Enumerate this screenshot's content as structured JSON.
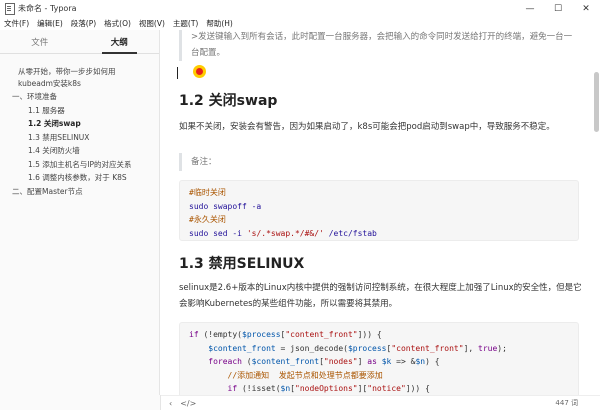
{
  "window": {
    "title": "未命名 - Typora",
    "controls": {
      "minimize": "—",
      "maximize": "☐",
      "close": "✕"
    }
  },
  "menu": [
    "文件(F)",
    "编辑(E)",
    "段落(P)",
    "格式(O)",
    "视图(V)",
    "主题(T)",
    "帮助(H)"
  ],
  "sidebar": {
    "tabs": {
      "files": "文件",
      "outline": "大纲"
    },
    "outline": [
      "从零开始，带你一步步如何用",
      "kubeadm安装k8s",
      "一、环境准备",
      "1.1 服务器",
      "1.2 关闭swap",
      "1.3 禁用SELINUX",
      "1.4 关闭防火墙",
      "1.5 添加主机名与IP的对应关系",
      "1.6 调整内核参数，对于 K8S",
      "二、配置Master节点"
    ]
  },
  "editor": {
    "quote_continuation": ">发送键输入到所有会话，此时配置一台服务器，会把输入的命令同时发送给打开的终端，避免一台一台配置。",
    "heading_swap": "1.2 关闭swap",
    "para_swap": "如果不关闭，安装会有警告，因为如果启动了，k8s可能会把pod启动到swap中，导致服务不稳定。",
    "note": "备注：",
    "code_swap": {
      "line1": "#临时关闭",
      "line2": "sudo swapoff -a",
      "line3": "#永久关闭",
      "line4_cmd": "sudo sed -i",
      "line4_str": "'s/.*swap.*/#&/'",
      "line4_rest": " /etc/fstab"
    },
    "heading_selinux": "1.3 禁用SELINUX",
    "para_selinux": "selinux是2.6+版本的Linux内核中提供的强制访问控制系统，在很大程度上加强了Linux的安全性，但是它会影响Kubernetes的某些组件功能，所以需要将其禁用。",
    "code_php": {
      "l1_kw": "if",
      "l1_a": " (!empty(",
      "l1_var": "$process",
      "l1_b": "[",
      "l1_str": "\"content_front\"",
      "l1_c": "])) {",
      "l2_var": "$content_front",
      "l2_a": " = json_decode(",
      "l2_var2": "$process",
      "l2_b": "[",
      "l2_str": "\"content_front\"",
      "l2_c": "], ",
      "l2_kw": "true",
      "l2_d": ");",
      "l3_kw": "foreach",
      "l3_a": " (",
      "l3_var": "$content_front",
      "l3_b": "[",
      "l3_str": "\"nodes\"",
      "l3_c": "] ",
      "l3_kw2": "as",
      "l3_d": " ",
      "l3_var2": "$k",
      "l3_e": " => &",
      "l3_var3": "$n",
      "l3_f": ") {",
      "l4_cmt": "//添加通知  发起节点和处理节点都要添加",
      "l5_kw": "if",
      "l5_a": " (!isset(",
      "l5_var": "$n",
      "l5_b": "[",
      "l5_str": "\"nodeOptions\"",
      "l5_c": "][",
      "l5_str2": "\"notice\"",
      "l5_d": "])) {"
    }
  },
  "statusbar": {
    "back_icon": "‹",
    "source_icon": "</>",
    "word_count": "447 词"
  }
}
